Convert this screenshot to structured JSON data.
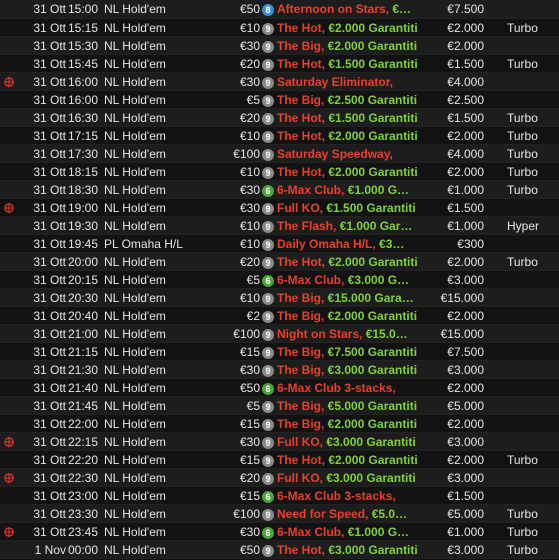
{
  "colors": {
    "name": "#e8402e",
    "guarantee": "#7fd13f",
    "badge_grey": "#8a8a8a",
    "badge_green": "#4aa53a",
    "badge_blue": "#3a8fd6",
    "marker": "#d4322a"
  },
  "tournaments": [
    {
      "marked": false,
      "date": "31 Ott",
      "time": "15:00",
      "game": "NL Hold'em",
      "buyin": "€50",
      "seats": "8",
      "badge": "blue",
      "name": "Afternoon on Stars",
      "sep": ", ",
      "guarantee": "€…",
      "prize": "€7.500",
      "speed": ""
    },
    {
      "marked": false,
      "date": "31 Ott",
      "time": "15:15",
      "game": "NL Hold'em",
      "buyin": "€10",
      "seats": "9",
      "badge": "grey",
      "name": "The Hot",
      "sep": ", ",
      "guarantee": "€2.000 Garantiti",
      "prize": "€2.000",
      "speed": "Turbo"
    },
    {
      "marked": false,
      "date": "31 Ott",
      "time": "15:30",
      "game": "NL Hold'em",
      "buyin": "€30",
      "seats": "9",
      "badge": "grey",
      "name": "The Big",
      "sep": ", ",
      "guarantee": "€2.000 Garantiti",
      "prize": "€2.000",
      "speed": ""
    },
    {
      "marked": false,
      "date": "31 Ott",
      "time": "15:45",
      "game": "NL Hold'em",
      "buyin": "€20",
      "seats": "9",
      "badge": "grey",
      "name": "The Hot",
      "sep": ", ",
      "guarantee": "€1.500 Garantiti",
      "prize": "€1.500",
      "speed": "Turbo"
    },
    {
      "marked": true,
      "date": "31 Ott",
      "time": "16:00",
      "game": "NL Hold'em",
      "buyin": "€30",
      "seats": "9",
      "badge": "grey",
      "name": "Saturday Eliminator",
      "sep": ",",
      "guarantee": "",
      "prize": "€4.000",
      "speed": ""
    },
    {
      "marked": false,
      "date": "31 Ott",
      "time": "16:00",
      "game": "NL Hold'em",
      "buyin": "€5",
      "seats": "9",
      "badge": "grey",
      "name": "The Big",
      "sep": ", ",
      "guarantee": "€2.500 Garantiti",
      "prize": "€2.500",
      "speed": ""
    },
    {
      "marked": false,
      "date": "31 Ott",
      "time": "16:30",
      "game": "NL Hold'em",
      "buyin": "€20",
      "seats": "9",
      "badge": "grey",
      "name": "The Hot",
      "sep": ", ",
      "guarantee": "€1.500 Garantiti",
      "prize": "€1.500",
      "speed": "Turbo"
    },
    {
      "marked": false,
      "date": "31 Ott",
      "time": "17:15",
      "game": "NL Hold'em",
      "buyin": "€10",
      "seats": "9",
      "badge": "grey",
      "name": "The Hot",
      "sep": ", ",
      "guarantee": "€2.000 Garantiti",
      "prize": "€2.000",
      "speed": "Turbo"
    },
    {
      "marked": false,
      "date": "31 Ott",
      "time": "17:30",
      "game": "NL Hold'em",
      "buyin": "€100",
      "seats": "9",
      "badge": "grey",
      "name": "Saturday Speedway",
      "sep": ",",
      "guarantee": "",
      "prize": "€4.000",
      "speed": "Turbo"
    },
    {
      "marked": false,
      "date": "31 Ott",
      "time": "18:15",
      "game": "NL Hold'em",
      "buyin": "€10",
      "seats": "9",
      "badge": "grey",
      "name": "The Hot",
      "sep": ", ",
      "guarantee": "€2.000 Garantiti",
      "prize": "€2.000",
      "speed": "Turbo"
    },
    {
      "marked": false,
      "date": "31 Ott",
      "time": "18:30",
      "game": "NL Hold'em",
      "buyin": "€30",
      "seats": "6",
      "badge": "green",
      "name": "6-Max Club",
      "sep": ", ",
      "guarantee": "€1.000 G…",
      "prize": "€1.000",
      "speed": "Turbo"
    },
    {
      "marked": true,
      "date": "31 Ott",
      "time": "19:00",
      "game": "NL Hold'em",
      "buyin": "€30",
      "seats": "9",
      "badge": "grey",
      "name": "Full KO",
      "sep": ", ",
      "guarantee": "€1.500 Garantiti",
      "prize": "€1.500",
      "speed": ""
    },
    {
      "marked": false,
      "date": "31 Ott",
      "time": "19:30",
      "game": "NL Hold'em",
      "buyin": "€10",
      "seats": "9",
      "badge": "grey",
      "name": "The Flash",
      "sep": ", ",
      "guarantee": "€1.000 Gar…",
      "prize": "€1.000",
      "speed": "Hyper"
    },
    {
      "marked": false,
      "date": "31 Ott",
      "time": "19:45",
      "game": "PL Omaha H/L",
      "buyin": "€10",
      "seats": "9",
      "badge": "grey",
      "name": "Daily Omaha H/L",
      "sep": ", ",
      "guarantee": "€3…",
      "prize": "€300",
      "speed": ""
    },
    {
      "marked": false,
      "date": "31 Ott",
      "time": "20:00",
      "game": "NL Hold'em",
      "buyin": "€20",
      "seats": "9",
      "badge": "grey",
      "name": "The Hot",
      "sep": ", ",
      "guarantee": "€2.000 Garantiti",
      "prize": "€2.000",
      "speed": "Turbo"
    },
    {
      "marked": false,
      "date": "31 Ott",
      "time": "20:15",
      "game": "NL Hold'em",
      "buyin": "€5",
      "seats": "6",
      "badge": "green",
      "name": "6-Max Club",
      "sep": ", ",
      "guarantee": "€3.000 G…",
      "prize": "€3.000",
      "speed": ""
    },
    {
      "marked": false,
      "date": "31 Ott",
      "time": "20:30",
      "game": "NL Hold'em",
      "buyin": "€10",
      "seats": "9",
      "badge": "grey",
      "name": "The Big",
      "sep": ", ",
      "guarantee": "€15.000 Gara…",
      "prize": "€15.000",
      "speed": ""
    },
    {
      "marked": false,
      "date": "31 Ott",
      "time": "20:40",
      "game": "NL Hold'em",
      "buyin": "€2",
      "seats": "9",
      "badge": "grey",
      "name": "The Big",
      "sep": ", ",
      "guarantee": "€2.000 Garantiti",
      "prize": "€2.000",
      "speed": ""
    },
    {
      "marked": false,
      "date": "31 Ott",
      "time": "21:00",
      "game": "NL Hold'em",
      "buyin": "€100",
      "seats": "9",
      "badge": "grey",
      "name": "Night on Stars",
      "sep": ", ",
      "guarantee": "€15.0…",
      "prize": "€15.000",
      "speed": ""
    },
    {
      "marked": false,
      "date": "31 Ott",
      "time": "21:15",
      "game": "NL Hold'em",
      "buyin": "€15",
      "seats": "9",
      "badge": "grey",
      "name": "The Big",
      "sep": ", ",
      "guarantee": "€7.500 Garantiti",
      "prize": "€7.500",
      "speed": ""
    },
    {
      "marked": false,
      "date": "31 Ott",
      "time": "21:30",
      "game": "NL Hold'em",
      "buyin": "€30",
      "seats": "9",
      "badge": "grey",
      "name": "The Big",
      "sep": ", ",
      "guarantee": "€3.000 Garantiti",
      "prize": "€3.000",
      "speed": ""
    },
    {
      "marked": false,
      "date": "31 Ott",
      "time": "21:40",
      "game": "NL Hold'em",
      "buyin": "€50",
      "seats": "6",
      "badge": "green",
      "name": "6-Max Club 3-stacks",
      "sep": ",",
      "guarantee": "",
      "prize": "€2.000",
      "speed": ""
    },
    {
      "marked": false,
      "date": "31 Ott",
      "time": "21:45",
      "game": "NL Hold'em",
      "buyin": "€5",
      "seats": "9",
      "badge": "grey",
      "name": "The Big",
      "sep": ", ",
      "guarantee": "€5.000 Garantiti",
      "prize": "€5.000",
      "speed": ""
    },
    {
      "marked": false,
      "date": "31 Ott",
      "time": "22:00",
      "game": "NL Hold'em",
      "buyin": "€15",
      "seats": "9",
      "badge": "grey",
      "name": "The Big",
      "sep": ", ",
      "guarantee": "€2.000 Garantiti",
      "prize": "€2.000",
      "speed": ""
    },
    {
      "marked": true,
      "date": "31 Ott",
      "time": "22:15",
      "game": "NL Hold'em",
      "buyin": "€30",
      "seats": "9",
      "badge": "grey",
      "name": "Full KO",
      "sep": ", ",
      "guarantee": "€3.000 Garantiti",
      "prize": "€3.000",
      "speed": ""
    },
    {
      "marked": false,
      "date": "31 Ott",
      "time": "22:20",
      "game": "NL Hold'em",
      "buyin": "€15",
      "seats": "9",
      "badge": "grey",
      "name": "The Hot",
      "sep": ", ",
      "guarantee": "€2.000 Garantiti",
      "prize": "€2.000",
      "speed": "Turbo"
    },
    {
      "marked": true,
      "date": "31 Ott",
      "time": "22:30",
      "game": "NL Hold'em",
      "buyin": "€20",
      "seats": "9",
      "badge": "grey",
      "name": "Full KO",
      "sep": ", ",
      "guarantee": "€3.000 Garantiti",
      "prize": "€3.000",
      "speed": ""
    },
    {
      "marked": false,
      "date": "31 Ott",
      "time": "23:00",
      "game": "NL Hold'em",
      "buyin": "€15",
      "seats": "6",
      "badge": "green",
      "name": "6-Max Club 3-stacks",
      "sep": ",",
      "guarantee": "",
      "prize": "€1.500",
      "speed": ""
    },
    {
      "marked": false,
      "date": "31 Ott",
      "time": "23:30",
      "game": "NL Hold'em",
      "buyin": "€100",
      "seats": "9",
      "badge": "grey",
      "name": "Need for Speed",
      "sep": ", ",
      "guarantee": "€5.0…",
      "prize": "€5.000",
      "speed": "Turbo"
    },
    {
      "marked": true,
      "date": "31 Ott",
      "time": "23:45",
      "game": "NL Hold'em",
      "buyin": "€30",
      "seats": "6",
      "badge": "green",
      "name": "6-Max Club",
      "sep": ", ",
      "guarantee": "€1.000 G…",
      "prize": "€1.000",
      "speed": "Turbo"
    },
    {
      "marked": false,
      "date": "1 Nov",
      "time": "00:00",
      "game": "NL Hold'em",
      "buyin": "€50",
      "seats": "9",
      "badge": "grey",
      "name": "The Hot",
      "sep": ", ",
      "guarantee": "€3.000 Garantiti",
      "prize": "€3.000",
      "speed": "Turbo"
    }
  ]
}
